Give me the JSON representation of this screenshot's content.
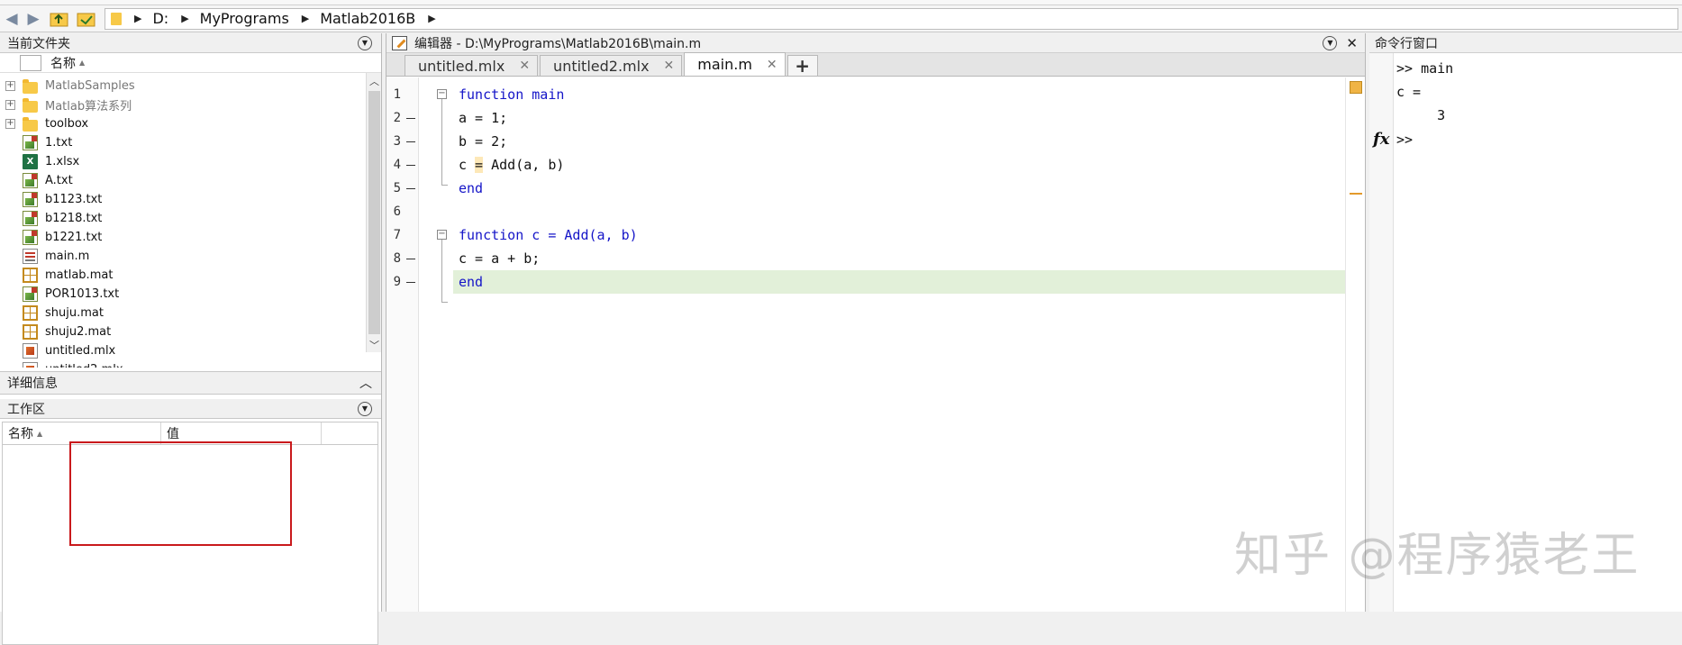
{
  "address_bar": {
    "path": [
      "D:",
      "MyPrograms",
      "Matlab2016B"
    ]
  },
  "current_folder": {
    "title": "当前文件夹",
    "column_name": "名称",
    "items": [
      {
        "name": "MatlabSamples",
        "type": "folder",
        "expandable": true,
        "dim": true
      },
      {
        "name": "Matlab算法系列",
        "type": "folder",
        "expandable": true,
        "dim": true
      },
      {
        "name": "toolbox",
        "type": "folder",
        "expandable": true,
        "dim": false
      },
      {
        "name": "1.txt",
        "type": "txt"
      },
      {
        "name": "1.xlsx",
        "type": "xlsx"
      },
      {
        "name": "A.txt",
        "type": "txt"
      },
      {
        "name": "b1123.txt",
        "type": "txt"
      },
      {
        "name": "b1218.txt",
        "type": "txt"
      },
      {
        "name": "b1221.txt",
        "type": "txt"
      },
      {
        "name": "main.m",
        "type": "m"
      },
      {
        "name": "matlab.mat",
        "type": "mat"
      },
      {
        "name": "POR1013.txt",
        "type": "txt"
      },
      {
        "name": "shuju.mat",
        "type": "mat"
      },
      {
        "name": "shuju2.mat",
        "type": "mat"
      },
      {
        "name": "untitled.mlx",
        "type": "mlx"
      },
      {
        "name": "untitled2.mlx",
        "type": "mlx"
      }
    ]
  },
  "details": {
    "title": "详细信息"
  },
  "workspace": {
    "title": "工作区",
    "col_name": "名称",
    "col_value": "值"
  },
  "editor": {
    "title": "编辑器 - D:\\MyPrograms\\Matlab2016B\\main.m",
    "tabs": [
      {
        "label": "untitled.mlx",
        "active": false
      },
      {
        "label": "untitled2.mlx",
        "active": false
      },
      {
        "label": "main.m",
        "active": true
      }
    ],
    "add_tab": "+",
    "lines": [
      {
        "n": "1",
        "code": "function main",
        "kw": true
      },
      {
        "n": "2",
        "code": "a = 1;"
      },
      {
        "n": "3",
        "code": "b = 2;"
      },
      {
        "n": "4",
        "code": "c = Add(a, b)"
      },
      {
        "n": "5",
        "code": "end",
        "kw": true
      },
      {
        "n": "6",
        "code": ""
      },
      {
        "n": "7",
        "code": "function c = Add(a, b)",
        "kw": true
      },
      {
        "n": "8",
        "code": "c = a + b;"
      },
      {
        "n": "9",
        "code": "end",
        "kw": true
      }
    ]
  },
  "command_window": {
    "title": "命令行窗口",
    "lines": [
      ">> main",
      "c =",
      "     3"
    ],
    "prompt": ">>",
    "fx_label": "fx"
  },
  "watermark": "知乎 @程序猿老王"
}
